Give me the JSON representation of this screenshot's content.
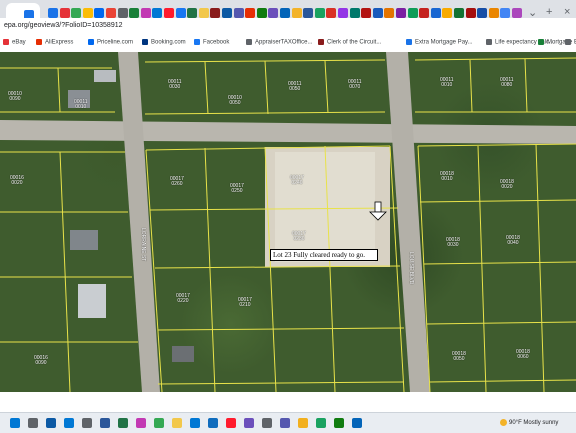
{
  "browser": {
    "url": "epa.org/geoview3/?FolioID=10358912",
    "tab_controls": {
      "dropdown": "⌄",
      "new_tab": "+",
      "close": "×"
    },
    "bookmarks": [
      {
        "label": "eBay",
        "color": "#e53238"
      },
      {
        "label": "AliExpress",
        "color": "#e62e04"
      },
      {
        "label": "Priceline.com",
        "color": "#0068ef"
      },
      {
        "label": "Booking.com",
        "color": "#003580"
      },
      {
        "label": "Facebook",
        "color": "#1877f2"
      },
      {
        "label": "AppraiserTAXOffice...",
        "color": "#5f6368"
      },
      {
        "label": "Clerk of the Circuit...",
        "color": "#8a1c1c"
      },
      {
        "label": "Extra Mortgage Pay...",
        "color": "#1a73e8"
      },
      {
        "label": "Life expectancy calc...",
        "color": "#5f6368"
      },
      {
        "label": "Mortgage Home Lo...",
        "color": "#188038"
      },
      {
        "label": "Bookmarks",
        "color": "#5f6368"
      }
    ]
  },
  "map": {
    "annotation": "Lot 23 Fully cleared ready to go.",
    "streets": [
      "LORRAINE ST",
      "LOUISE BLVD"
    ],
    "parcels": [
      {
        "id": "p1",
        "line1": "00011",
        "line2": "0010"
      },
      {
        "id": "p2",
        "line1": "00010",
        "line2": "0090"
      },
      {
        "id": "p3",
        "line1": "00011",
        "line2": "0030"
      },
      {
        "id": "p4",
        "line1": "00010",
        "line2": "0050"
      },
      {
        "id": "p5",
        "line1": "00011",
        "line2": "0050"
      },
      {
        "id": "p6",
        "line1": "00011",
        "line2": "0070"
      },
      {
        "id": "p7",
        "line1": "00011",
        "line2": "0010"
      },
      {
        "id": "p8",
        "line1": "00011",
        "line2": "0080"
      },
      {
        "id": "p9",
        "line1": "00017",
        "line2": "0260"
      },
      {
        "id": "p10",
        "line1": "00017",
        "line2": "0250"
      },
      {
        "id": "p11",
        "line1": "00017",
        "line2": "0240"
      },
      {
        "id": "p12",
        "line1": "00017",
        "line2": "0230"
      },
      {
        "id": "p13",
        "line1": "00017",
        "line2": "0220"
      },
      {
        "id": "p14",
        "line1": "00017",
        "line2": "0210"
      },
      {
        "id": "p15",
        "line1": "00018",
        "line2": "0010"
      },
      {
        "id": "p16",
        "line1": "00018",
        "line2": "0020"
      },
      {
        "id": "p17",
        "line1": "00018",
        "line2": "0030"
      },
      {
        "id": "p18",
        "line1": "00018",
        "line2": "0040"
      },
      {
        "id": "p19",
        "line1": "00016",
        "line2": "0020"
      },
      {
        "id": "p20",
        "line1": "00016",
        "line2": "0090"
      },
      {
        "id": "p21",
        "line1": "00018",
        "line2": "0050"
      },
      {
        "id": "p22",
        "line1": "00018",
        "line2": "0060"
      }
    ]
  },
  "taskbar": {
    "apps": [
      {
        "name": "start",
        "color": "#0078d4"
      },
      {
        "name": "search",
        "color": "#5f6368"
      },
      {
        "name": "edge",
        "color": "#0c59a4"
      },
      {
        "name": "outlook",
        "color": "#0078d4"
      },
      {
        "name": "store",
        "color": "#5f6368"
      },
      {
        "name": "word",
        "color": "#2b579a"
      },
      {
        "name": "excel",
        "color": "#217346"
      },
      {
        "name": "photos",
        "color": "#c239b3"
      },
      {
        "name": "chrome",
        "color": "#34a853"
      },
      {
        "name": "explorer",
        "color": "#f2c84b"
      },
      {
        "name": "mail",
        "color": "#0078d4"
      },
      {
        "name": "photos2",
        "color": "#0f6cbd"
      },
      {
        "name": "opera",
        "color": "#ff1b2d"
      },
      {
        "name": "media",
        "color": "#6b4fbb"
      },
      {
        "name": "settings",
        "color": "#5f6368"
      },
      {
        "name": "teams",
        "color": "#5558af"
      },
      {
        "name": "notes",
        "color": "#f2b01e"
      },
      {
        "name": "maps",
        "color": "#1aa260"
      },
      {
        "name": "game",
        "color": "#107c10"
      },
      {
        "name": "onedrive",
        "color": "#0364b8"
      }
    ],
    "weather": "90°F  Mostly sunny"
  }
}
